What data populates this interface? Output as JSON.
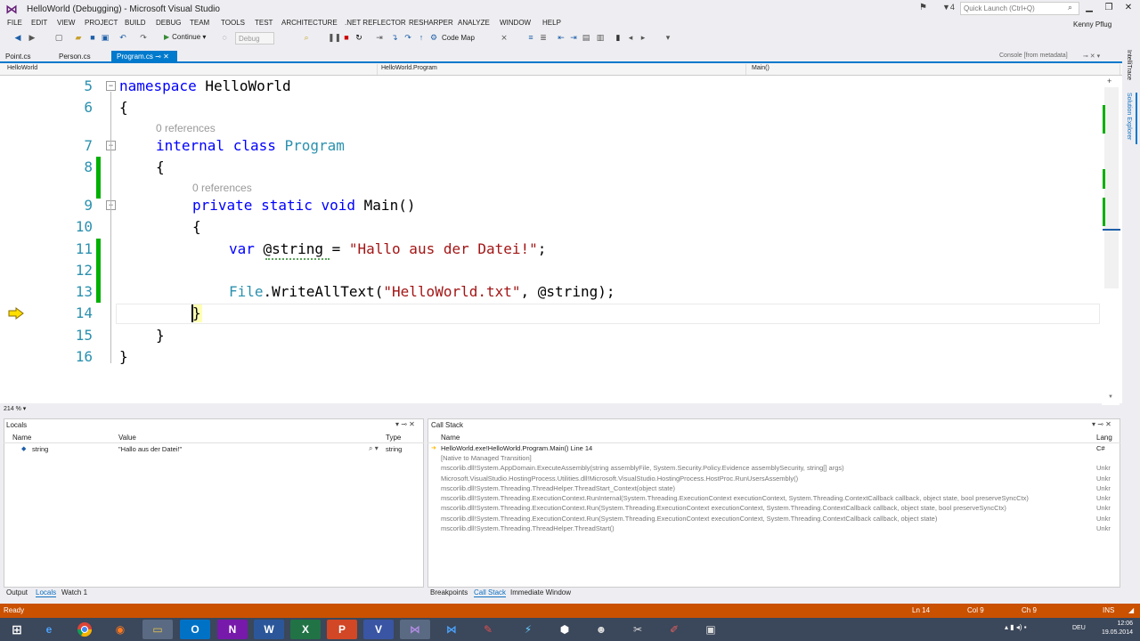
{
  "window": {
    "title": "HelloWorld (Debugging) - Microsoft Visual Studio",
    "quick_launch_placeholder": "Quick Launch (Ctrl+Q)",
    "notification_count": "4",
    "user_name": "Kenny Pflug"
  },
  "menu": [
    "FILE",
    "EDIT",
    "VIEW",
    "PROJECT",
    "BUILD",
    "DEBUG",
    "TEAM",
    "TOOLS",
    "TEST",
    "ARCHITECTURE",
    ".NET REFLECTOR",
    "RESHARPER",
    "ANALYZE",
    "WINDOW",
    "HELP"
  ],
  "toolbar": {
    "continue_label": "Continue",
    "config_value": "Debug",
    "code_map_label": "Code Map"
  },
  "tabs": {
    "open": [
      "Point.cs",
      "Person.cs",
      "Program.cs"
    ],
    "active": "Program.cs",
    "preview": "Console [from metadata]"
  },
  "navbar": {
    "project": "HelloWorld",
    "type": "HelloWorld.Program",
    "member": "Main()"
  },
  "editor": {
    "zoom": "214 %",
    "ref_hint": "0 references",
    "line_numbers": [
      "5",
      "6",
      "7",
      "8",
      "9",
      "10",
      "11",
      "12",
      "13",
      "14",
      "15",
      "16"
    ],
    "code": {
      "l5_kw": "namespace",
      "l5_name": " HelloWorld",
      "l6": "{",
      "l7_kw": "internal class",
      "l7_name": " Program",
      "l8": "{",
      "l9_kw": "private static void",
      "l9_name": " Main()",
      "l10": "{",
      "l11_kw": "var",
      "l11_mid": " @string = ",
      "l11_str": "\"Hallo aus der Datei!\"",
      "l11_end": ";",
      "l13_type": "File",
      "l13_mid": ".WriteAllText(",
      "l13_str": "\"HelloWorld.txt\"",
      "l13_end": ", @string);",
      "l14": "}",
      "l15": "}",
      "l16": "}"
    }
  },
  "side_tabs": [
    "IntelliTrace",
    "Solution Explorer"
  ],
  "locals": {
    "title": "Locals",
    "columns": [
      "Name",
      "Value",
      "Type"
    ],
    "rows": [
      {
        "name": "string",
        "value": "\"Hallo aus der Datei!\"",
        "type": "string"
      }
    ]
  },
  "callstack": {
    "title": "Call Stack",
    "columns": [
      "Name",
      "Lang"
    ],
    "rows": [
      {
        "name": "HelloWorld.exe!HelloWorld.Program.Main() Line 14",
        "lang": "C#",
        "current": true
      },
      {
        "name": "[Native to Managed Transition]",
        "lang": "",
        "current": false
      },
      {
        "name": "mscorlib.dll!System.AppDomain.ExecuteAssembly(string assemblyFile, System.Security.Policy.Evidence assemblySecurity, string[] args)",
        "lang": "Unkr",
        "current": false
      },
      {
        "name": "Microsoft.VisualStudio.HostingProcess.Utilities.dll!Microsoft.VisualStudio.HostingProcess.HostProc.RunUsersAssembly()",
        "lang": "Unkr",
        "current": false
      },
      {
        "name": "mscorlib.dll!System.Threading.ThreadHelper.ThreadStart_Context(object state)",
        "lang": "Unkr",
        "current": false
      },
      {
        "name": "mscorlib.dll!System.Threading.ExecutionContext.RunInternal(System.Threading.ExecutionContext executionContext, System.Threading.ContextCallback callback, object state, bool preserveSyncCtx)",
        "lang": "Unkr",
        "current": false
      },
      {
        "name": "mscorlib.dll!System.Threading.ExecutionContext.Run(System.Threading.ExecutionContext executionContext, System.Threading.ContextCallback callback, object state, bool preserveSyncCtx)",
        "lang": "Unkr",
        "current": false
      },
      {
        "name": "mscorlib.dll!System.Threading.ExecutionContext.Run(System.Threading.ExecutionContext executionContext, System.Threading.ContextCallback callback, object state)",
        "lang": "Unkr",
        "current": false
      },
      {
        "name": "mscorlib.dll!System.Threading.ThreadHelper.ThreadStart()",
        "lang": "Unkr",
        "current": false
      }
    ]
  },
  "bottom_tabs_left": [
    "Output",
    "Locals",
    "Watch 1"
  ],
  "bottom_tabs_right": [
    "Breakpoints",
    "Call Stack",
    "Immediate Window"
  ],
  "status": {
    "state": "Ready",
    "ln": "Ln 14",
    "col": "Col 9",
    "ch": "Ch 9",
    "mode": "INS"
  },
  "taskbar": {
    "lang": "DEU",
    "time": "12:06",
    "date": "19.05.2014"
  },
  "colors": {
    "accent": "#007acc",
    "status_bar": "#ca5100",
    "keyword": "#0000ff",
    "type": "#2b91af",
    "string": "#a31515",
    "changed_margin": "#00b000"
  }
}
